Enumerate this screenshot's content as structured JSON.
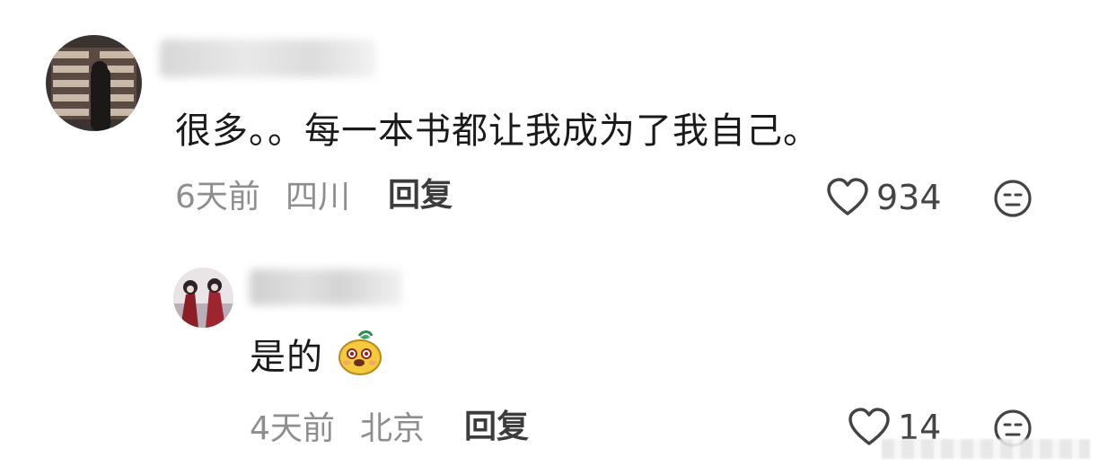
{
  "comments": [
    {
      "username": "",
      "text": "很多。。每一本书都让我成为了我自己。",
      "time": "6天前",
      "location": "四川",
      "reply_label": "回复",
      "likes": "934"
    },
    {
      "username": "",
      "text": "是的",
      "time": "4天前",
      "location": "北京",
      "reply_label": "回复",
      "likes": "14"
    }
  ],
  "icons": {
    "like": "heart-icon",
    "dislike": "neutral-face-icon",
    "emoji": "dog-emoji-icon"
  }
}
